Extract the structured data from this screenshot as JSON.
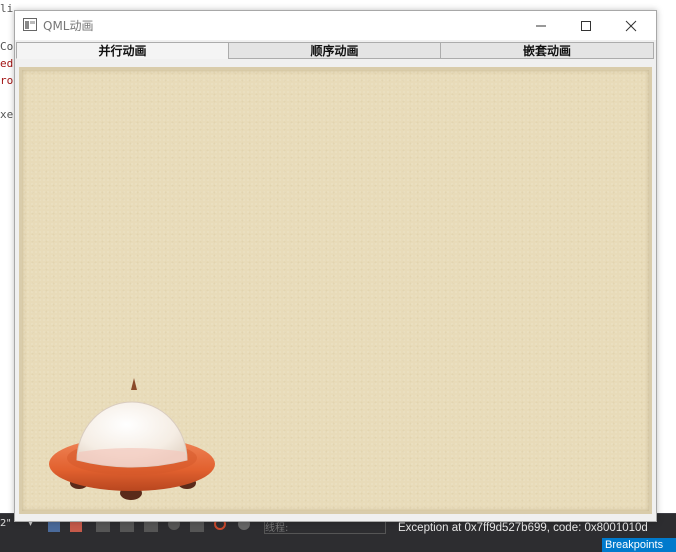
{
  "background_ide": {
    "code_lines": [
      "li",
      "Co",
      "ed",
      "ro",
      "xe"
    ],
    "toolbar_text": "线程:",
    "exception_text": "Exception at 0x7ff9d527b699, code: 0x8001010d",
    "breakpoints_tab": "Breakpoints"
  },
  "window": {
    "title": "QML动画",
    "controls": {
      "minimize": "minimize-icon",
      "maximize": "maximize-icon",
      "close": "close-icon"
    }
  },
  "tabs": [
    {
      "label": "并行动画",
      "active": true
    },
    {
      "label": "顺序动画",
      "active": false
    },
    {
      "label": "嵌套动画",
      "active": false
    }
  ],
  "scene": {
    "background_color": "#e8dbb9",
    "ufo": {
      "saucer_color": "#e8663b",
      "dome_color": "#f7f1ea"
    }
  }
}
